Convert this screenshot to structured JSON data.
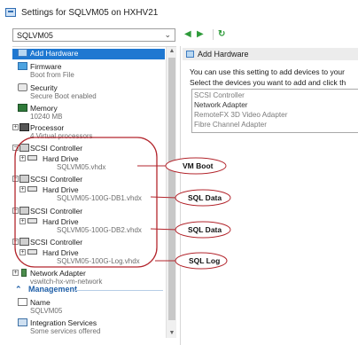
{
  "window": {
    "title": "Settings for SQLVM05 on HXHV21"
  },
  "vm_selector": {
    "value": "SQLVM05"
  },
  "toolbar": {
    "back_label": "◀",
    "forward_label": "▶",
    "refresh_label": "↻"
  },
  "tree": {
    "hardware_items": [
      {
        "label": "Add Hardware",
        "sub": ""
      },
      {
        "label": "Firmware",
        "sub": "Boot from File"
      },
      {
        "label": "Security",
        "sub": "Secure Boot enabled"
      },
      {
        "label": "Memory",
        "sub": "10240 MB"
      },
      {
        "label": "Processor",
        "sub": "4 Virtual processors"
      },
      {
        "label": "SCSI Controller",
        "sub": ""
      },
      {
        "label": "Hard Drive",
        "sub": "SQLVM05.vhdx"
      },
      {
        "label": "SCSI Controller",
        "sub": ""
      },
      {
        "label": "Hard Drive",
        "sub": "SQLVM05-100G-DB1.vhdx"
      },
      {
        "label": "SCSI Controller",
        "sub": ""
      },
      {
        "label": "Hard Drive",
        "sub": "SQLVM05-100G-DB2.vhdx"
      },
      {
        "label": "SCSI Controller",
        "sub": ""
      },
      {
        "label": "Hard Drive",
        "sub": "SQLVM05-100G-Log.vhdx"
      },
      {
        "label": "Network Adapter",
        "sub": "vswitch-hx-vm-network"
      }
    ],
    "management_header": "Management",
    "management_items": [
      {
        "label": "Name",
        "sub": "SQLVM05"
      },
      {
        "label": "Integration Services",
        "sub": "Some services offered"
      }
    ]
  },
  "right_pane": {
    "header": "Add Hardware",
    "line1": "You can use this setting to add devices to your",
    "line2": "Select the devices you want to add and click th",
    "devices": [
      "SCSI Controller",
      "Network Adapter",
      "RemoteFX 3D Video Adapter",
      "Fibre Channel Adapter"
    ]
  },
  "annotations": {
    "boot": "VM Boot",
    "data1": "SQL Data",
    "data2": "SQL Data",
    "log": "SQL Log"
  },
  "colors": {
    "selection": "#1f78d1",
    "annotation_red": "#b3262d",
    "management_blue": "#1f5fa8"
  }
}
